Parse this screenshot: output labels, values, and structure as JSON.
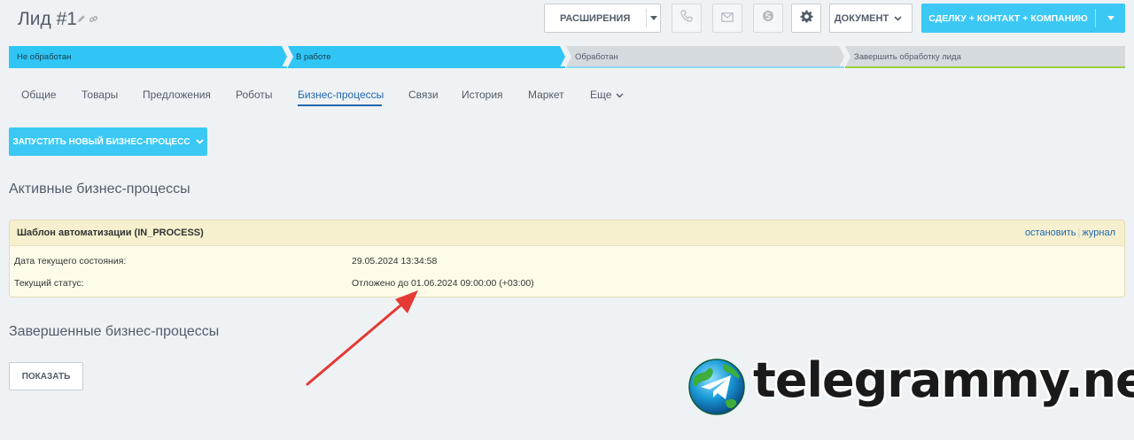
{
  "header": {
    "title": "Лид #1",
    "extensions_label": "РАСШИРЕНИЯ",
    "document_label": "ДОКУМЕНТ",
    "main_action_label": "СДЕЛКУ + КОНТАКТ + КОМПАНИЮ",
    "icons": [
      "pencil-icon",
      "link-icon",
      "phone-icon",
      "mail-icon",
      "skype-icon",
      "gear-icon"
    ]
  },
  "stages": [
    {
      "label": "Не обработан",
      "state": "done"
    },
    {
      "label": "В работе",
      "state": "current"
    },
    {
      "label": "Обработан",
      "state": "pending"
    },
    {
      "label": "Завершить обработку лида",
      "state": "final"
    }
  ],
  "tabs": [
    {
      "label": "Общие"
    },
    {
      "label": "Товары"
    },
    {
      "label": "Предложения"
    },
    {
      "label": "Роботы"
    },
    {
      "label": "Бизнес-процессы",
      "active": true
    },
    {
      "label": "Связи"
    },
    {
      "label": "История"
    },
    {
      "label": "Маркет"
    },
    {
      "label": "Еще"
    }
  ],
  "launch_button_label": "ЗАПУСТИТЬ НОВЫЙ БИЗНЕС-ПРОЦЕСС",
  "active_section": {
    "title": "Активные бизнес-процессы",
    "process": {
      "name": "Шаблон автоматизации (IN_PROCESS)",
      "stop_link": "остановить",
      "log_link": "журнал",
      "rows": [
        {
          "label": "Дата текущего состояния:",
          "value": "29.05.2024 13:34:58"
        },
        {
          "label": "Текущий статус:",
          "value": "Отложено до 01.06.2024 09:00:00 (+03:00)"
        }
      ]
    }
  },
  "completed_section": {
    "title": "Завершенные бизнес-процессы",
    "show_button_label": "ПОКАЗАТЬ"
  },
  "watermark": {
    "text": "telegrammy.net"
  },
  "colors": {
    "accent": "#3bc8f5",
    "stage_active": "#2fc6f6",
    "stage_inactive": "#d5dadf",
    "link": "#2067b0",
    "card_bg": "#fefbe9",
    "arrow": "#e53935"
  }
}
